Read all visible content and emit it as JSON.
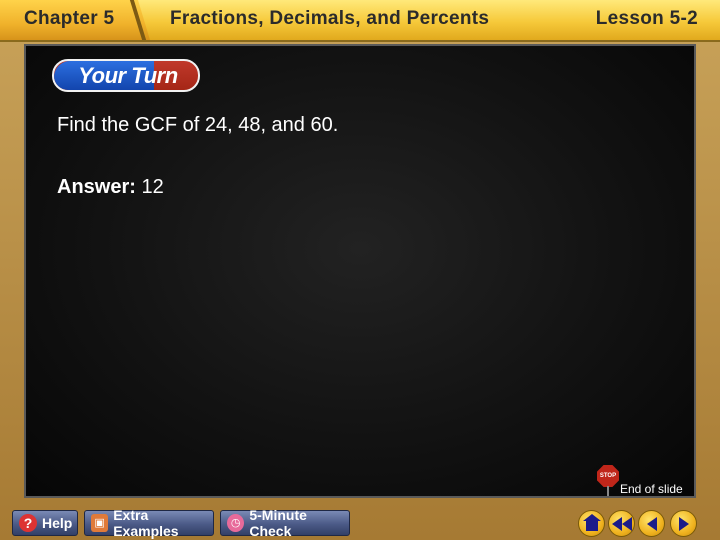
{
  "header": {
    "chapter": "Chapter 5",
    "title": "Fractions, Decimals, and Percents",
    "lesson": "Lesson 5-2"
  },
  "slide": {
    "badge": "Your Turn",
    "question": "Find the GCF of 24, 48, and 60.",
    "answer_label": "Answer:",
    "answer_value": "12",
    "end_label": "End of slide",
    "stop_text": "STOP"
  },
  "footer": {
    "help": "Help",
    "extra_examples": "Extra Examples",
    "five_minute_check": "5-Minute Check",
    "icons": [
      "question-icon",
      "examples-icon",
      "clock-icon",
      "home-icon",
      "rewind-icon",
      "previous-icon",
      "next-icon"
    ]
  },
  "colors": {
    "header_yellow": "#f6c93a",
    "panel_dark": "#121212",
    "badge_blue": "#1f56c8",
    "badge_red": "#b22e1e",
    "footer_button": "#4b5a87",
    "nav_gold": "#f0b31f"
  }
}
